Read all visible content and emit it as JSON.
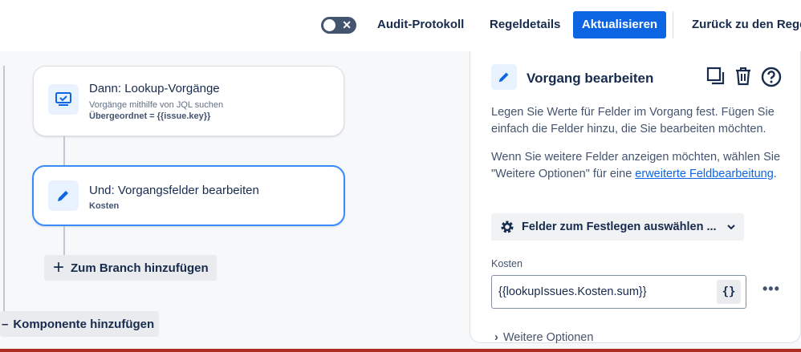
{
  "topbar": {
    "audit_log": "Audit-Protokoll",
    "rule_details": "Regeldetails",
    "update": "Aktualisieren",
    "back": "Zurück zu den Rege"
  },
  "canvas": {
    "card1": {
      "title": "Dann: Lookup-Vorgänge",
      "subtitle": "Vorgänge mithilfe von JQL suchen",
      "detail": "Übergeordnet = {{issue.key}}"
    },
    "card2": {
      "title": "Und: Vorgangsfelder bearbeiten",
      "detail": "Kosten"
    },
    "add_branch": "Zum Branch hinzufügen",
    "add_component": "Komponente hinzufügen"
  },
  "panel": {
    "title": "Vorgang bearbeiten",
    "description": "Legen Sie Werte für Felder im Vorgang fest. Fügen Sie einfach die Felder hinzu, die Sie bearbeiten möchten.",
    "more_text_before": "Wenn Sie weitere Felder anzeigen möchten, wählen Sie \"Weitere Optionen\" für eine ",
    "more_text_link": "erweiterte Feldbearbeitung",
    "more_text_after": ".",
    "fields_select": "Felder zum Festlegen auswählen ...",
    "field_label": "Kosten",
    "field_value": "{{lookupIssues.Kosten.sum}}",
    "curly_label": "{}",
    "more_options": "Weitere Optionen"
  },
  "colors": {
    "primary": "#0c66e4",
    "selected_border": "#388bff",
    "bottom_bar": "#ae2e24"
  }
}
